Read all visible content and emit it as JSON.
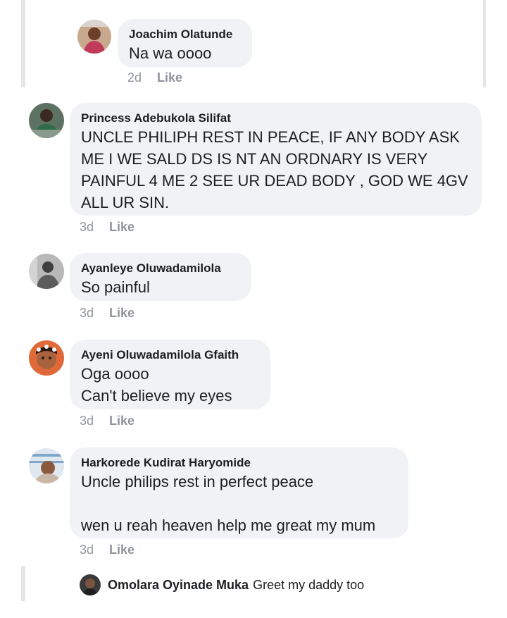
{
  "comments": [
    {
      "author": "Joachim Olatunde",
      "lines": [
        "Na wa oooo"
      ],
      "time": "2d",
      "like": "Like",
      "avatar_icon": "person-avatar-icon"
    },
    {
      "author": "Princess Adebukola Silifat",
      "lines": [
        "UNCLE PHILIPH REST IN PEACE, IF ANY BODY ASK ME I WE SALD DS IS NT AN ORDNARY IS VERY PAINFUL 4 ME 2 SEE UR DEAD BODY , GOD WE 4GV ALL UR SIN."
      ],
      "time": "3d",
      "like": "Like",
      "avatar_icon": "person-avatar-icon"
    },
    {
      "author": "Ayanleye Oluwadamilola",
      "lines": [
        "So painful"
      ],
      "time": "3d",
      "like": "Like",
      "avatar_icon": "person-avatar-icon"
    },
    {
      "author": "Ayeni Oluwadamilola Gfaith",
      "lines": [
        "Oga oooo",
        "Can't believe my eyes"
      ],
      "time": "3d",
      "like": "Like",
      "avatar_icon": "person-avatar-icon"
    },
    {
      "author": "Harkorede Kudirat Haryomide",
      "lines": [
        "Uncle philips rest in perfect peace",
        "",
        "wen u reah heaven help me great my mum"
      ],
      "time": "3d",
      "like": "Like",
      "avatar_icon": "person-avatar-icon"
    }
  ],
  "reply_preview": {
    "author": "Omolara Oyinade Muka",
    "text": "Greet my daddy too",
    "avatar_icon": "person-avatar-icon"
  }
}
